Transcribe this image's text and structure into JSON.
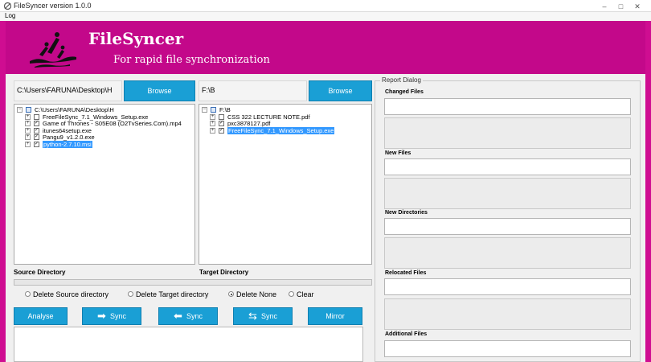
{
  "window": {
    "title": "FileSyncer version 1.0.0",
    "controls": [
      "–",
      "□",
      "✕"
    ]
  },
  "menu": {
    "log": "Log"
  },
  "banner": {
    "title": "FileSyncer",
    "subtitle": "For rapid file synchronization",
    "color": "#c3088a"
  },
  "source": {
    "path": "C:\\Users\\FARUNA\\Desktop\\H",
    "browse_label": "Browse",
    "label": "Source Directory",
    "tree": {
      "root": "C:\\Users\\FARUNA\\Desktop\\H",
      "items": [
        {
          "label": "FreeFileSync_7.1_Windows_Setup.exe",
          "checked": false,
          "selected": false
        },
        {
          "label": "Game of Thrones - S05E08 (O2TvSeries.Com).mp4",
          "checked": true,
          "selected": false
        },
        {
          "label": "itunes64setup.exe",
          "checked": true,
          "selected": false
        },
        {
          "label": "Pangu9_v1.2.0.exe",
          "checked": true,
          "selected": false
        },
        {
          "label": "python-2.7.10.msi",
          "checked": true,
          "selected": true
        }
      ]
    }
  },
  "target": {
    "path": "F:\\B",
    "browse_label": "Browse",
    "label": "Target Directory",
    "tree": {
      "root": "F:\\B",
      "items": [
        {
          "label": "CSS 322 LECTURE NOTE.pdf",
          "checked": false,
          "selected": false
        },
        {
          "label": "pxc3878127.pdf",
          "checked": true,
          "selected": false
        },
        {
          "label": "FreeFileSync_7.1_Windows_Setup.exe",
          "checked": true,
          "selected": true
        }
      ]
    }
  },
  "options": {
    "delete_source": "Delete Source directory",
    "delete_target": "Delete Target directory",
    "delete_none": "Delete None",
    "clear": "Clear",
    "selected": "delete_none"
  },
  "actions": {
    "analyse": "Analyse",
    "sync_right": "Sync",
    "sync_left": "Sync",
    "sync_both": "Sync",
    "mirror": "Mirror",
    "accent": "#1a9fd5"
  },
  "report": {
    "title": "Report Dialog",
    "sections": {
      "changed": "Changed Files",
      "new_files": "New Files",
      "new_dirs": "New Directories",
      "relocated": "Relocated Files",
      "additional": "Additional Files"
    }
  }
}
